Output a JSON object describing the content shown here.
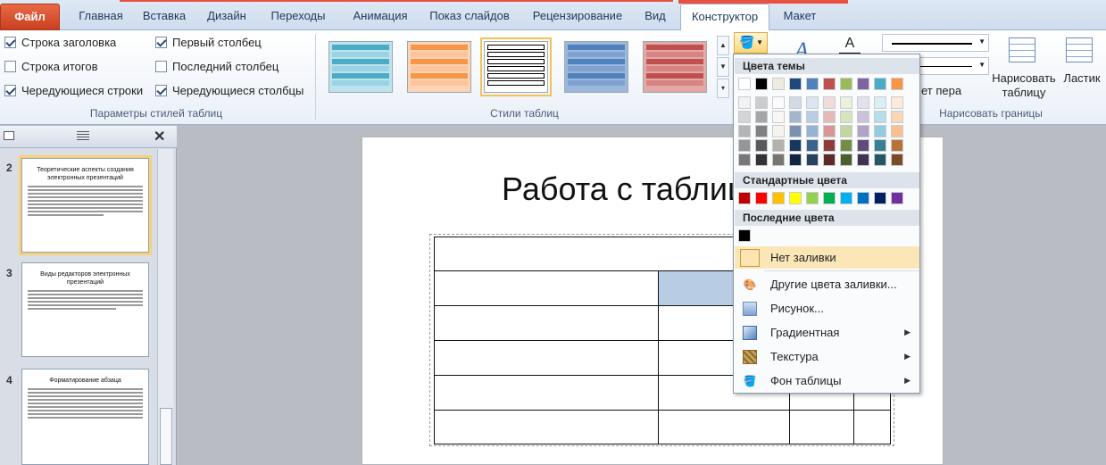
{
  "ribbon_tabs": {
    "file": "Файл",
    "home": "Главная",
    "insert": "Вставка",
    "design": "Дизайн",
    "transitions": "Переходы",
    "animation": "Анимация",
    "slideshow": "Показ слайдов",
    "review": "Рецензирование",
    "view": "Вид",
    "constructor": "Конструктор",
    "layout": "Макет"
  },
  "style_options": {
    "header_row": "Строка заголовка",
    "total_row": "Строка итогов",
    "banded_rows": "Чередующиеся строки",
    "first_column": "Первый столбец",
    "last_column": "Последний столбец",
    "banded_columns": "Чередующиеся столбцы",
    "group_label": "Параметры стилей таблиц"
  },
  "table_styles": {
    "group_label": "Стили таблиц",
    "colors": [
      "#4bacc6",
      "#f79646",
      "#ffffff",
      "#4f81bd",
      "#c0504d"
    ]
  },
  "draw_borders": {
    "pen_weight": "ет пера",
    "draw_table": "Нарисовать таблицу",
    "eraser": "Ластик",
    "group_label": "Нарисовать границы"
  },
  "slides": [
    {
      "number": "2",
      "title": "Теоретические аспекты создания электронных презентаций"
    },
    {
      "number": "3",
      "title": "Виды редакторов электронных презентаций"
    },
    {
      "number": "4",
      "title": "Форматирование абзаца"
    }
  ],
  "slide_title": "Работа с таблиц",
  "fill_menu": {
    "theme_colors_label": "Цвета темы",
    "standard_colors_label": "Стандартные цвета",
    "recent_colors_label": "Последние цвета",
    "no_fill": "Нет заливки",
    "more_colors": "Другие цвета заливки...",
    "picture": "Рисунок...",
    "gradient": "Градиентная",
    "texture": "Текстура",
    "table_background": "Фон таблицы",
    "theme_top_row": [
      "#ffffff",
      "#000000",
      "#eeece1",
      "#1f497d",
      "#4f81bd",
      "#c0504d",
      "#9bbb59",
      "#8064a2",
      "#4bacc6",
      "#f79646"
    ],
    "standard_colors": [
      "#c00000",
      "#ff0000",
      "#ffc000",
      "#ffff00",
      "#92d050",
      "#00b050",
      "#00b0f0",
      "#0070c0",
      "#002060",
      "#7030a0"
    ],
    "recent_colors": [
      "#000000"
    ]
  }
}
